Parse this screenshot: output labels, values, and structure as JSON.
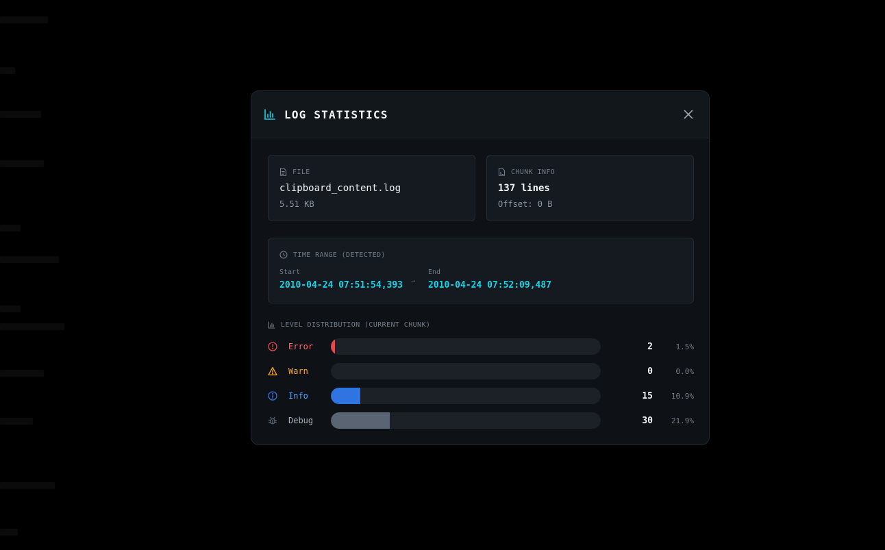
{
  "modal": {
    "title": "LOG STATISTICS",
    "icon": "bar-chart-icon",
    "close_icon": "close-icon"
  },
  "file_card": {
    "label": "FILE",
    "icon": "file-icon",
    "name": "clipboard_content.log",
    "size": "5.51 KB"
  },
  "chunk_card": {
    "label": "CHUNK INFO",
    "icon": "file-lines-icon",
    "lines": "137 lines",
    "offset": "Offset: 0 B"
  },
  "time_range": {
    "label": "TIME RANGE (DETECTED)",
    "icon": "clock-icon",
    "start_label": "Start",
    "start_value": "2010-04-24 07:51:54,393",
    "arrow": "→",
    "end_label": "End",
    "end_value": "2010-04-24 07:52:09,487"
  },
  "distribution": {
    "label": "LEVEL DISTRIBUTION (CURRENT CHUNK)",
    "icon": "bar-chart-icon",
    "levels": [
      {
        "name": "Error",
        "count": "2",
        "percent": "1.5%",
        "fraction": 0.015,
        "color": "#e5484d",
        "text_color": "#f07178",
        "icon": "error-circle-icon"
      },
      {
        "name": "Warn",
        "count": "0",
        "percent": "0.0%",
        "fraction": 0.0,
        "color": "#f5a524",
        "text_color": "#f5a524",
        "icon": "warning-triangle-icon"
      },
      {
        "name": "Info",
        "count": "15",
        "percent": "10.9%",
        "fraction": 0.109,
        "color": "#2f74e0",
        "text_color": "#5aa2ff",
        "icon": "info-circle-icon"
      },
      {
        "name": "Debug",
        "count": "30",
        "percent": "21.9%",
        "fraction": 0.219,
        "color": "#5a6473",
        "text_color": "#a8b0ba",
        "icon": "bug-icon"
      }
    ]
  },
  "colors": {
    "accent": "#19d3e6",
    "background": "#0e1216",
    "card": "#151a20"
  }
}
